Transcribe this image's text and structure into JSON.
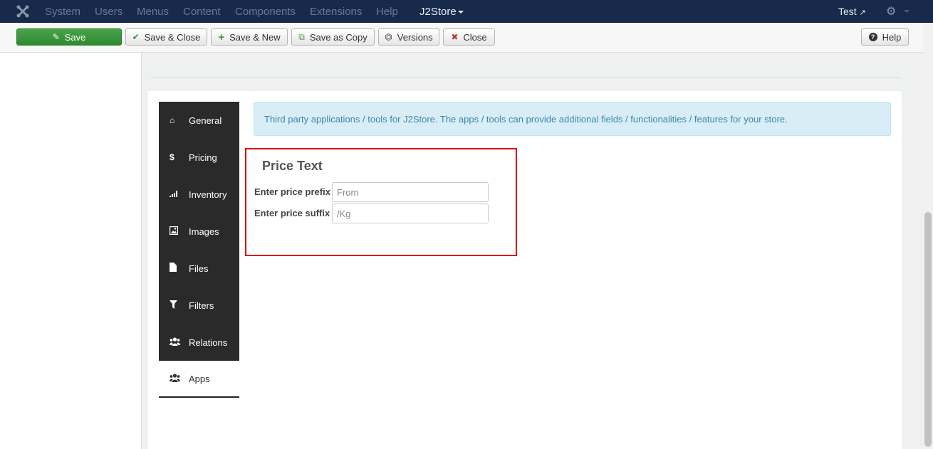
{
  "navbar": {
    "items": [
      "System",
      "Users",
      "Menus",
      "Content",
      "Components",
      "Extensions",
      "Help"
    ],
    "active_item": "J2Store",
    "user": "Test"
  },
  "toolbar": {
    "save": "Save",
    "save_close": "Save & Close",
    "save_new": "Save & New",
    "save_copy": "Save as Copy",
    "versions": "Versions",
    "close": "Close",
    "help": "Help"
  },
  "tabs": [
    {
      "label": "General",
      "icon": "home-icon"
    },
    {
      "label": "Pricing",
      "icon": "dollar-icon"
    },
    {
      "label": "Inventory",
      "icon": "signal-icon"
    },
    {
      "label": "Images",
      "icon": "image-icon"
    },
    {
      "label": "Files",
      "icon": "file-icon"
    },
    {
      "label": "Filters",
      "icon": "filter-icon"
    },
    {
      "label": "Relations",
      "icon": "users-icon"
    },
    {
      "label": "Apps",
      "icon": "users-icon"
    }
  ],
  "active_tab": "Apps",
  "apps": {
    "alert": "Third party applications / tools for J2Store. The apps / tools can provide additional fields / functionalities / features for your store.",
    "price_text": {
      "title": "Price Text",
      "prefix_label": "Enter price prefix",
      "prefix_value": "From",
      "suffix_label": "Enter price suffix",
      "suffix_value": "/Kg"
    }
  },
  "colors": {
    "navbar": "#172a4b",
    "save_button": "#3c963c",
    "highlight_border": "#d60000",
    "alert_bg": "#d9edf7"
  }
}
